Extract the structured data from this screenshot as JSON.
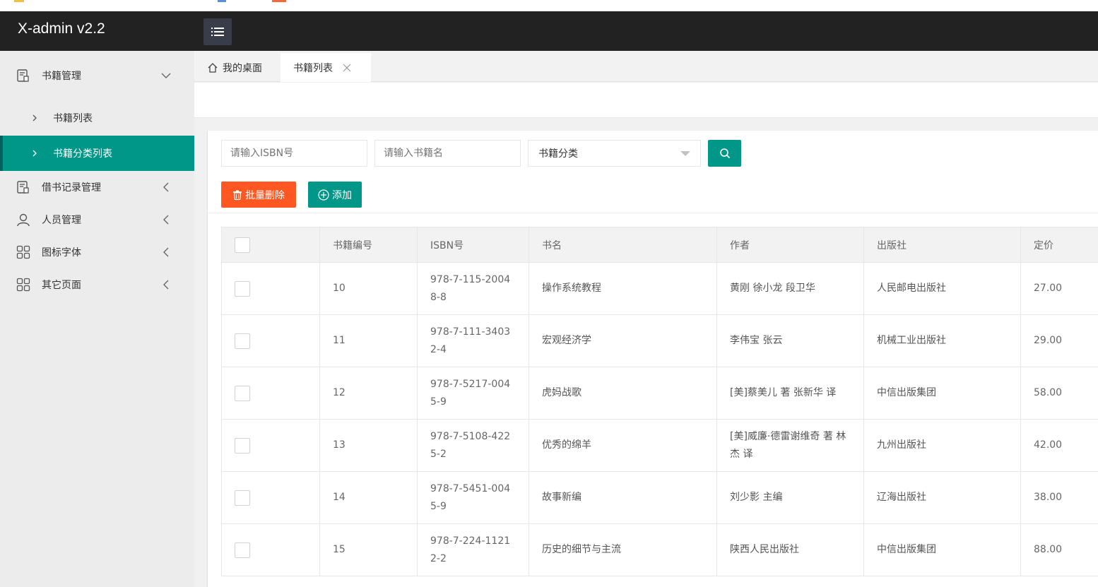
{
  "app": {
    "title": "X-admin v2.2"
  },
  "header": {
    "menu_toggle": "menu-icon"
  },
  "sidebar": {
    "groups": [
      {
        "label": "书籍管理",
        "icon": "book-doc-icon",
        "expanded": true,
        "children": [
          {
            "label": "书籍列表",
            "active": false
          },
          {
            "label": "书籍分类列表",
            "active": true
          }
        ]
      },
      {
        "label": "借书记录管理",
        "icon": "book-doc-icon",
        "expanded": false
      },
      {
        "label": "人员管理",
        "icon": "user-icon",
        "expanded": false
      },
      {
        "label": "图标字体",
        "icon": "grid-icon",
        "expanded": false
      },
      {
        "label": "其它页面",
        "icon": "grid-icon",
        "expanded": false
      }
    ]
  },
  "tabs": {
    "home": "我的桌面",
    "active": "书籍列表"
  },
  "search": {
    "isbn_placeholder": "请输入ISBN号",
    "name_placeholder": "请输入书籍名",
    "category_selected": "书籍分类"
  },
  "actions": {
    "batch_delete": "批量删除",
    "add": "添加"
  },
  "table": {
    "headers": [
      "书籍编号",
      "ISBN号",
      "书名",
      "作者",
      "出版社",
      "定价"
    ],
    "rows": [
      {
        "id": "10",
        "isbn": "978-7-115-20048-8",
        "title": "操作系统教程",
        "author": "黄刚 徐小龙 段卫华",
        "publisher": "人民邮电出版社",
        "price": "27.00"
      },
      {
        "id": "11",
        "isbn": "978-7-111-34032-4",
        "title": "宏观经济学",
        "author": "李伟宝 张云",
        "publisher": "机械工业出版社",
        "price": "29.00"
      },
      {
        "id": "12",
        "isbn": "978-7-5217-0045-9",
        "title": "虎妈战歌",
        "author": "[美]蔡美儿 著 张新华 译",
        "publisher": "中信出版集团",
        "price": "58.00"
      },
      {
        "id": "13",
        "isbn": "978-7-5108-4225-2",
        "title": "优秀的绵羊",
        "author": "[美]威廉·德雷谢维奇 著 林杰 译",
        "publisher": "九州出版社",
        "price": "42.00"
      },
      {
        "id": "14",
        "isbn": "978-7-5451-0045-9",
        "title": "故事新编",
        "author": "刘少影 主编",
        "publisher": "辽海出版社",
        "price": "38.00"
      },
      {
        "id": "15",
        "isbn": "978-7-224-11212-2",
        "title": "历史的细节与主流",
        "author": "陕西人民出版社",
        "publisher": "中信出版集团",
        "price": "88.00"
      }
    ]
  },
  "colors": {
    "topbar": "#222222",
    "accent": "#009688",
    "danger": "#ff5722",
    "sidebar_bg": "#ececec"
  }
}
